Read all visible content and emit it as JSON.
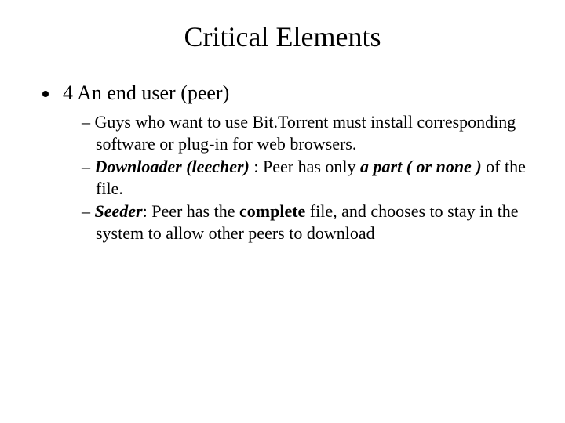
{
  "title": "Critical Elements",
  "bullet1": "4 An end user (peer)",
  "sub1": "Guys who want to use Bit.Torrent must install corresponding software or plug-in for web browsers.",
  "sub2_downloader": "Downloader (leecher)",
  "sub2_colon": " : Peer has only ",
  "sub2_part": "a part ( or none )",
  "sub2_tail": " of the file.",
  "sub3_seeder": "Seeder",
  "sub3_colon": ": Peer has the ",
  "sub3_complete": "complete",
  "sub3_tail": " file, and chooses to stay in the system to allow other peers to download"
}
